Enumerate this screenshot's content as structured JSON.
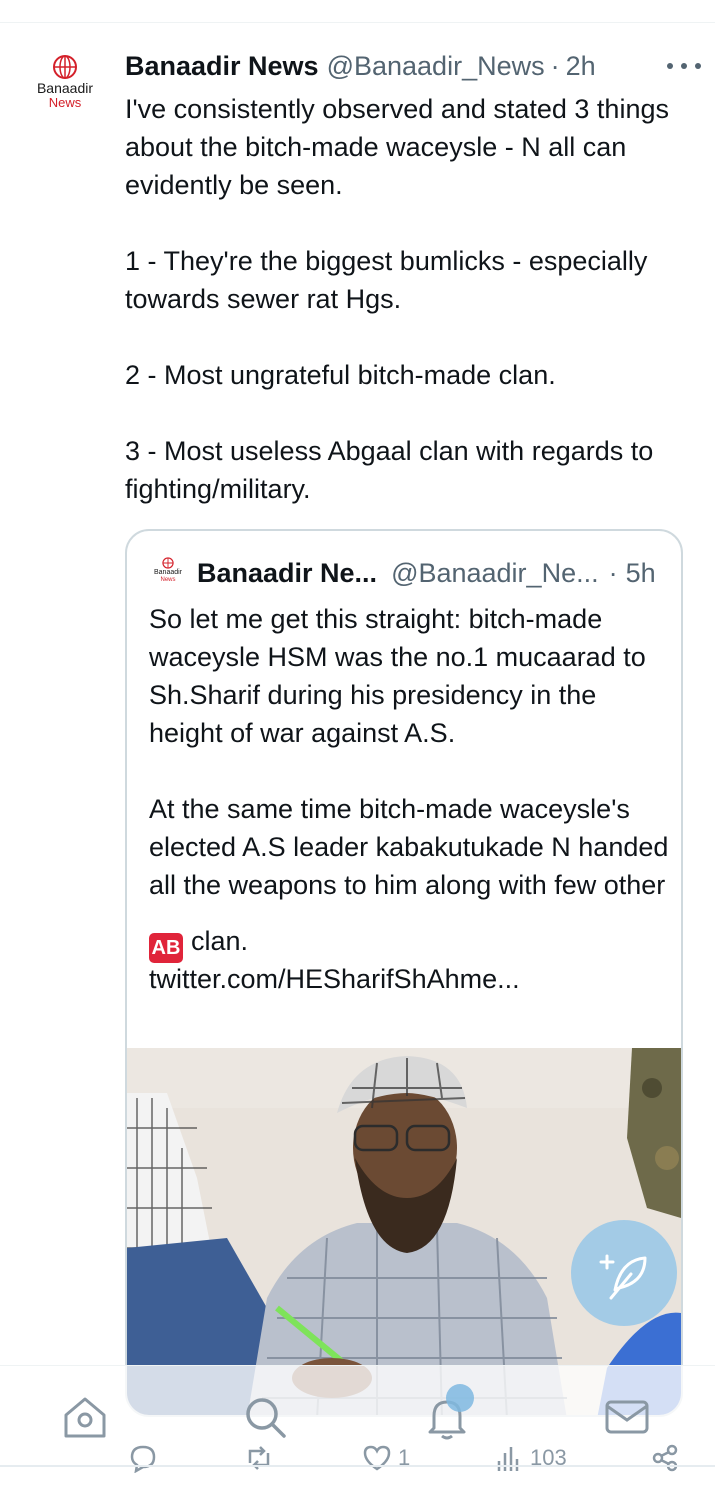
{
  "tweet": {
    "display_name": "Banaadir News",
    "handle": "@Banaadir_News",
    "separator": "·",
    "time": "2h",
    "avatar": {
      "line1": "Banaadir",
      "line2": "News"
    },
    "text": "I've consistently observed and stated 3 things about the bitch-made waceysle - N all can evidently be seen.\n\n1 - They're the biggest bumlicks - especially towards sewer rat Hgs.\n\n2 - Most ungrateful bitch-made clan.\n\n3 - Most useless Abgaal clan with regards to fighting/military.",
    "more_icon": "more-horizontal-icon"
  },
  "quoted_tweet": {
    "display_name": "Banaadir Ne...",
    "handle": "@Banaadir_Ne...",
    "separator": "·",
    "time": "5h",
    "avatar": {
      "line1": "Banaadir",
      "line2": "News"
    },
    "text": "So let me get this straight: bitch-made waceysle HSM was the no.1 mucaarad to Sh.Sharif during his presidency in the height of war against A.S.\n\nAt the same time bitch-made waceysle's elected A.S leader kabakutukade N handed all the weapons to him along with few other",
    "badge": "AB",
    "text_after_badge": "clan.",
    "link": "twitter.com/HESharifShAhme..."
  },
  "actions": {
    "reply_count": "",
    "retweet_count": "",
    "like_count": "1",
    "views_count": "103"
  },
  "nav": {
    "items": [
      "home-icon",
      "search-icon",
      "notifications-icon",
      "messages-icon"
    ]
  },
  "colors": {
    "text": "#0f1419",
    "secondary": "#536471",
    "border": "#cfd9de",
    "fab": "#8bc3ea",
    "brand_red": "#d4202a"
  }
}
